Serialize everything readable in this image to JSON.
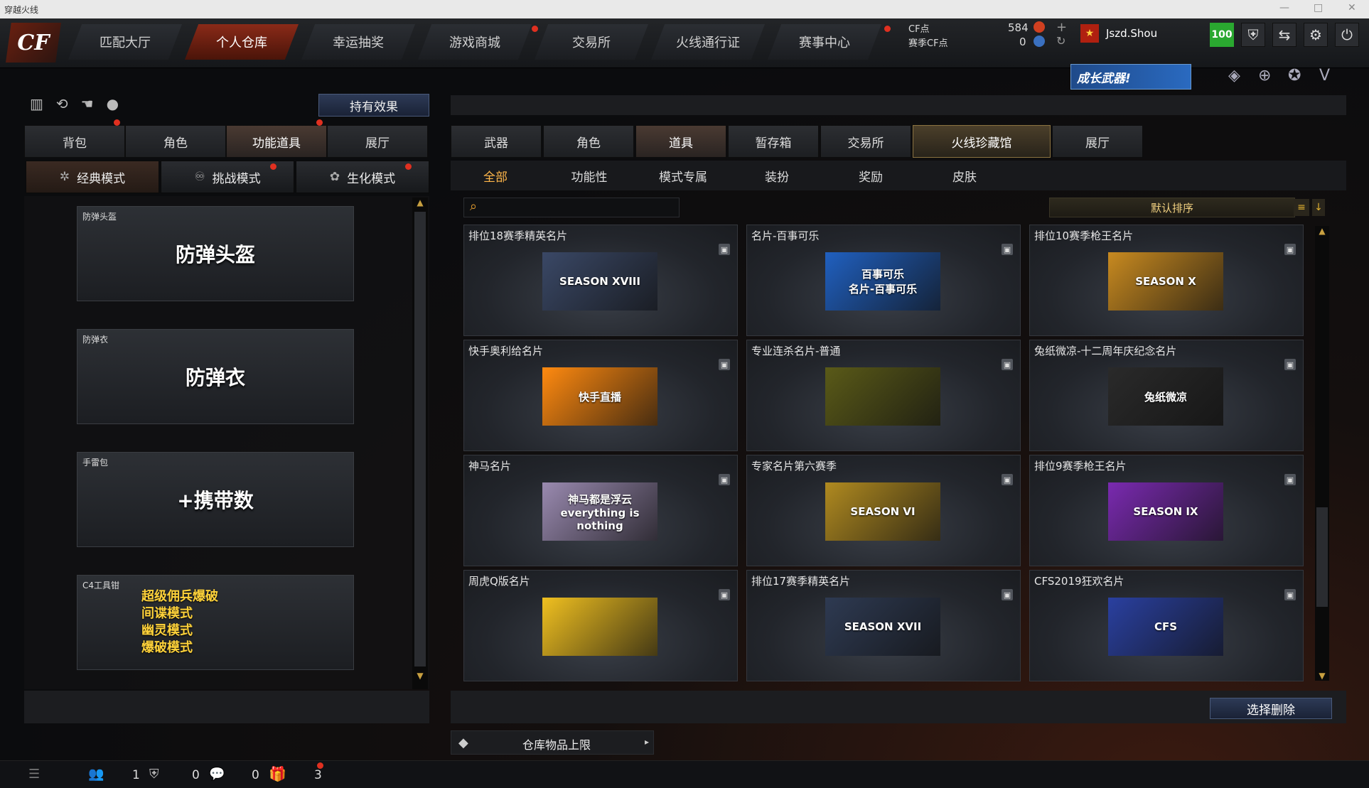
{
  "window_title": "穿越火线",
  "nav": {
    "logo_text": "CF",
    "tabs": [
      "匹配大厅",
      "个人仓库",
      "幸运抽奖",
      "游戏商城",
      "交易所",
      "火线通行证",
      "赛事中心"
    ],
    "active_index": 1
  },
  "currency": {
    "cf_label": "CF点",
    "cf_value": "584",
    "season_cf_label": "赛季CF点",
    "season_cf_value": "0"
  },
  "user": {
    "name": "Jszd.Shou",
    "level": "100"
  },
  "banner_text": "成长武器!",
  "left": {
    "effect_button": "持有效果",
    "tabs": [
      "背包",
      "角色",
      "功能道具",
      "展厅"
    ],
    "active_tab": 2,
    "modes": [
      "经典模式",
      "挑战模式",
      "生化模式"
    ],
    "items": [
      {
        "label": "防弹头盔",
        "big": "防弹头盔"
      },
      {
        "label": "防弹衣",
        "big": "防弹衣"
      },
      {
        "label": "手雷包",
        "big": "+携带数"
      },
      {
        "label": "C4工具钳",
        "big_lines": [
          "超级佣兵爆破",
          "间谍模式",
          "幽灵模式",
          "爆破模式"
        ]
      }
    ]
  },
  "right": {
    "tabs": [
      "武器",
      "角色",
      "道具",
      "暂存箱",
      "交易所",
      "火线珍藏馆",
      "展厅"
    ],
    "active_tab": 2,
    "highlight_tab": 5,
    "subtabs": [
      "全部",
      "功能性",
      "模式专属",
      "装扮",
      "奖励",
      "皮肤"
    ],
    "active_subtab": 0,
    "search_placeholder": "",
    "sort_label": "默认排序",
    "cards": [
      {
        "name": "排位18赛季精英名片",
        "art": "SEASON XVIII",
        "color": "#3a4866"
      },
      {
        "name": "名片-百事可乐",
        "art": "百事可乐\n名片-百事可乐",
        "color": "#2060c0"
      },
      {
        "name": "排位10赛季枪王名片",
        "art": "SEASON X",
        "color": "#c88a20"
      },
      {
        "name": "快手奥利给名片",
        "art": "快手直播",
        "color": "#ff8a10"
      },
      {
        "name": "专业连杀名片-普通",
        "art": "",
        "color": "#5a5a18"
      },
      {
        "name": "兔纸微凉-十二周年庆纪念名片",
        "art": "兔纸微凉",
        "color": "#2a2a2a"
      },
      {
        "name": "神马名片",
        "art": "神马都是浮云\neverything is nothing",
        "color": "#9a8ab0"
      },
      {
        "name": "专家名片第六赛季",
        "art": "SEASON VI",
        "color": "#b08a20"
      },
      {
        "name": "排位9赛季枪王名片",
        "art": "SEASON IX",
        "color": "#7a2ab0"
      },
      {
        "name": "周虎Q版名片",
        "art": "",
        "color": "#f0c020"
      },
      {
        "name": "排位17赛季精英名片",
        "art": "SEASON XVII",
        "color": "#2e3a52"
      },
      {
        "name": "CFS2019狂欢名片",
        "art": "CFS",
        "color": "#2a40a0"
      }
    ],
    "delete_button": "选择删除",
    "storage_label": "仓库物品上限"
  },
  "bottom": {
    "counts": [
      "1",
      "0",
      "0",
      "3"
    ]
  }
}
